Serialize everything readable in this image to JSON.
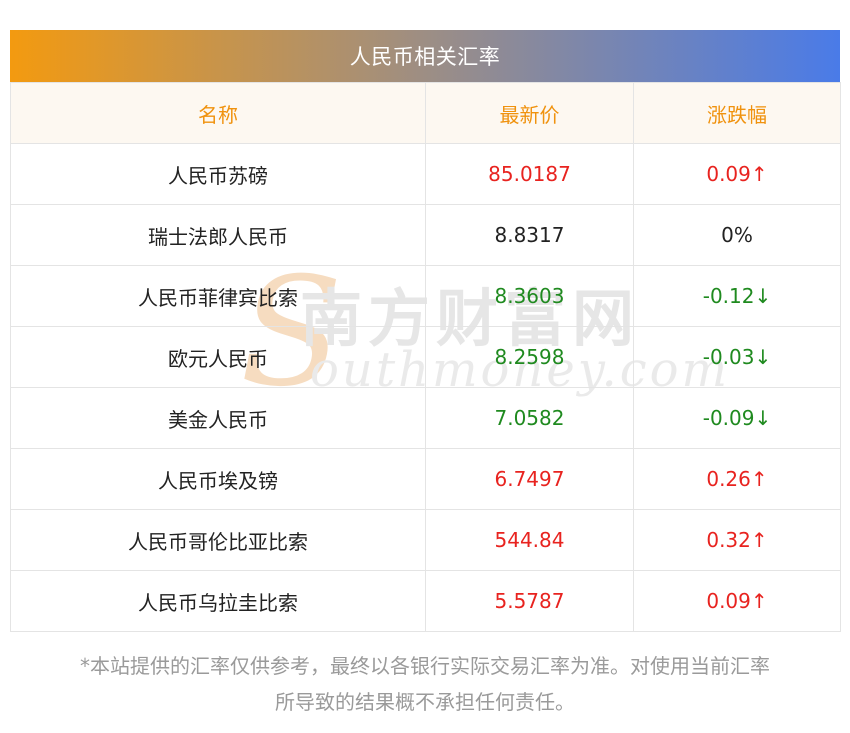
{
  "table": {
    "title": "人民币相关汇率",
    "headers": {
      "name": "名称",
      "price": "最新价",
      "change": "涨跌幅"
    },
    "rows": [
      {
        "name": "人民币苏磅",
        "price": "85.0187",
        "change": "0.09↑",
        "trend": "up"
      },
      {
        "name": "瑞士法郎人民币",
        "price": "8.8317",
        "change": "0%",
        "trend": "flat"
      },
      {
        "name": "人民币菲律宾比索",
        "price": "8.3603",
        "change": "-0.12↓",
        "trend": "down"
      },
      {
        "name": "欧元人民币",
        "price": "8.2598",
        "change": "-0.03↓",
        "trend": "down"
      },
      {
        "name": "美金人民币",
        "price": "7.0582",
        "change": "-0.09↓",
        "trend": "down"
      },
      {
        "name": "人民币埃及镑",
        "price": "6.7497",
        "change": "0.26↑",
        "trend": "up"
      },
      {
        "name": "人民币哥伦比亚比索",
        "price": "544.84",
        "change": "0.32↑",
        "trend": "up"
      },
      {
        "name": "人民币乌拉圭比索",
        "price": "5.5787",
        "change": "0.09↑",
        "trend": "up"
      }
    ]
  },
  "watermark": {
    "mark": "S",
    "cn": "南方财富网",
    "en": "outhmoney.com"
  },
  "disclaimer": {
    "line1": "*本站提供的汇率仅供参考，最终以各银行实际交易汇率为准。对使用当前汇率",
    "line2": "所导致的结果概不承担任何责任。"
  },
  "colors": {
    "header_text": "#f0920e",
    "up": "#e8231f",
    "down": "#1f8a1f",
    "title_gradient": [
      "#f39a10",
      "#4a7be8"
    ]
  }
}
